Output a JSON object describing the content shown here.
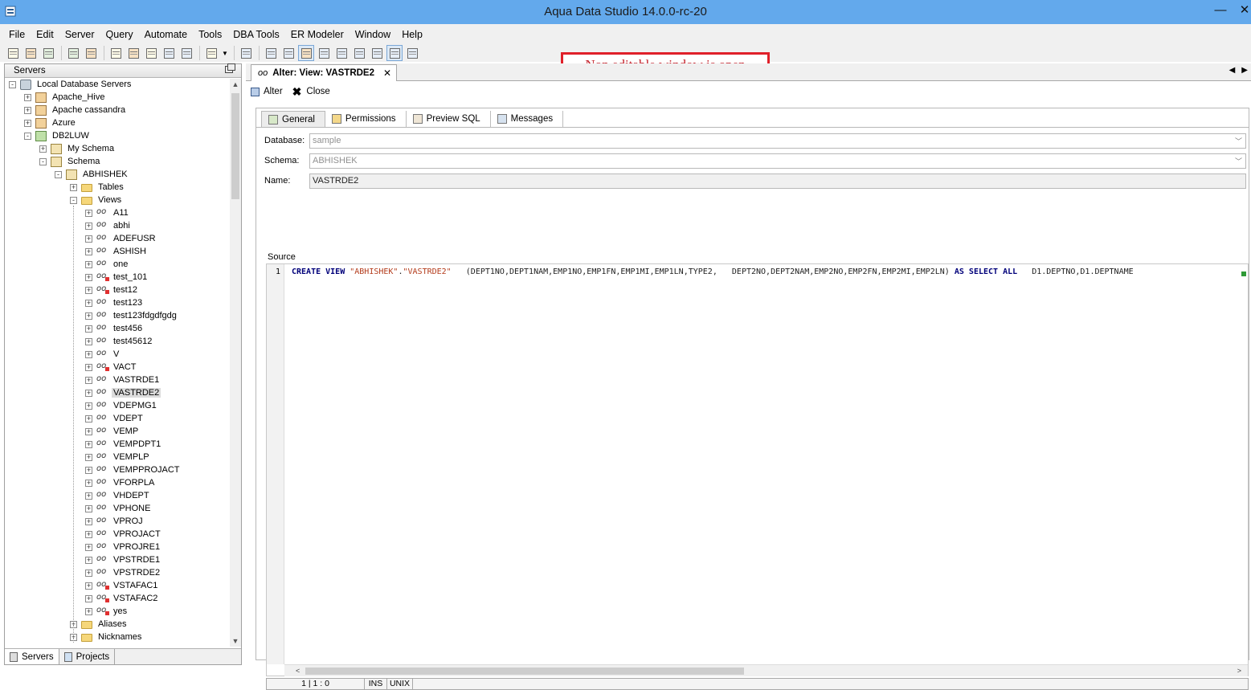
{
  "window": {
    "title": "Aqua Data Studio 14.0.0-rc-20",
    "min_glyph": "—",
    "close_glyph": "✕"
  },
  "menu": [
    "File",
    "Edit",
    "Server",
    "Query",
    "Automate",
    "Tools",
    "DBA Tools",
    "ER Modeler",
    "Window",
    "Help"
  ],
  "annotation": "Non editable window is open",
  "left_panel": {
    "title": "Servers",
    "tree": [
      {
        "label": "Local Database Servers",
        "depth": 0,
        "expander": "-",
        "icon": "srv"
      },
      {
        "label": "Apache_Hive",
        "depth": 1,
        "expander": "+",
        "icon": "db"
      },
      {
        "label": "Apache cassandra",
        "depth": 1,
        "expander": "+",
        "icon": "db"
      },
      {
        "label": "Azure",
        "depth": 1,
        "expander": "+",
        "icon": "db"
      },
      {
        "label": "DB2LUW",
        "depth": 1,
        "expander": "-",
        "icon": "dbg"
      },
      {
        "label": "My Schema",
        "depth": 2,
        "expander": "+",
        "icon": "sch"
      },
      {
        "label": "Schema",
        "depth": 2,
        "expander": "-",
        "icon": "sch"
      },
      {
        "label": "ABHISHEK",
        "depth": 3,
        "expander": "-",
        "icon": "sch"
      },
      {
        "label": "Tables",
        "depth": 4,
        "expander": "+",
        "icon": "folder"
      },
      {
        "label": "Views",
        "depth": 4,
        "expander": "-",
        "icon": "folder"
      },
      {
        "label": "A11",
        "depth": 5,
        "expander": "+",
        "icon": "view"
      },
      {
        "label": "abhi",
        "depth": 5,
        "expander": "+",
        "icon": "view"
      },
      {
        "label": "ADEFUSR",
        "depth": 5,
        "expander": "+",
        "icon": "view"
      },
      {
        "label": "ASHISH",
        "depth": 5,
        "expander": "+",
        "icon": "view"
      },
      {
        "label": "one",
        "depth": 5,
        "expander": "+",
        "icon": "view"
      },
      {
        "label": "test_101",
        "depth": 5,
        "expander": "+",
        "icon": "view-bad"
      },
      {
        "label": "test12",
        "depth": 5,
        "expander": "+",
        "icon": "view-bad"
      },
      {
        "label": "test123",
        "depth": 5,
        "expander": "+",
        "icon": "view"
      },
      {
        "label": "test123fdgdfgdg",
        "depth": 5,
        "expander": "+",
        "icon": "view"
      },
      {
        "label": "test456",
        "depth": 5,
        "expander": "+",
        "icon": "view"
      },
      {
        "label": "test45612",
        "depth": 5,
        "expander": "+",
        "icon": "view"
      },
      {
        "label": "V",
        "depth": 5,
        "expander": "+",
        "icon": "view"
      },
      {
        "label": "VACT",
        "depth": 5,
        "expander": "+",
        "icon": "view-bad"
      },
      {
        "label": "VASTRDE1",
        "depth": 5,
        "expander": "+",
        "icon": "view"
      },
      {
        "label": "VASTRDE2",
        "depth": 5,
        "expander": "+",
        "icon": "view",
        "selected": true
      },
      {
        "label": "VDEPMG1",
        "depth": 5,
        "expander": "+",
        "icon": "view"
      },
      {
        "label": "VDEPT",
        "depth": 5,
        "expander": "+",
        "icon": "view"
      },
      {
        "label": "VEMP",
        "depth": 5,
        "expander": "+",
        "icon": "view"
      },
      {
        "label": "VEMPDPT1",
        "depth": 5,
        "expander": "+",
        "icon": "view"
      },
      {
        "label": "VEMPLP",
        "depth": 5,
        "expander": "+",
        "icon": "view"
      },
      {
        "label": "VEMPPROJACT",
        "depth": 5,
        "expander": "+",
        "icon": "view"
      },
      {
        "label": "VFORPLA",
        "depth": 5,
        "expander": "+",
        "icon": "view"
      },
      {
        "label": "VHDEPT",
        "depth": 5,
        "expander": "+",
        "icon": "view"
      },
      {
        "label": "VPHONE",
        "depth": 5,
        "expander": "+",
        "icon": "view"
      },
      {
        "label": "VPROJ",
        "depth": 5,
        "expander": "+",
        "icon": "view"
      },
      {
        "label": "VPROJACT",
        "depth": 5,
        "expander": "+",
        "icon": "view"
      },
      {
        "label": "VPROJRE1",
        "depth": 5,
        "expander": "+",
        "icon": "view"
      },
      {
        "label": "VPSTRDE1",
        "depth": 5,
        "expander": "+",
        "icon": "view"
      },
      {
        "label": "VPSTRDE2",
        "depth": 5,
        "expander": "+",
        "icon": "view"
      },
      {
        "label": "VSTAFAC1",
        "depth": 5,
        "expander": "+",
        "icon": "view-bad"
      },
      {
        "label": "VSTAFAC2",
        "depth": 5,
        "expander": "+",
        "icon": "view-bad"
      },
      {
        "label": "yes",
        "depth": 5,
        "expander": "+",
        "icon": "view-bad"
      },
      {
        "label": "Aliases",
        "depth": 4,
        "expander": "+",
        "icon": "folder"
      },
      {
        "label": "Nicknames",
        "depth": 4,
        "expander": "+",
        "icon": "folder"
      }
    ],
    "bottom_tabs": [
      "Servers",
      "Projects"
    ]
  },
  "editor": {
    "tab_title": "Alter: View: VASTRDE2",
    "actions": {
      "alter": "Alter",
      "close": "Close"
    },
    "tabs": [
      "General",
      "Permissions",
      "Preview SQL",
      "Messages"
    ],
    "fields": {
      "database": {
        "label": "Database:",
        "value": "sample"
      },
      "schema": {
        "label": "Schema:",
        "value": "ABHISHEK"
      },
      "name": {
        "label": "Name:",
        "value": "VASTRDE2"
      }
    },
    "source_label": "Source",
    "line_number": "1",
    "code": [
      {
        "t": "CREATE VIEW ",
        "c": "kw"
      },
      {
        "t": "\"ABHISHEK\"",
        "c": "str"
      },
      {
        "t": ".",
        "c": "plain"
      },
      {
        "t": "\"VASTRDE2\"",
        "c": "str"
      },
      {
        "t": "   (DEPT1NO,DEPT1NAM,EMP1NO,EMP1FN,EMP1MI,EMP1LN,TYPE2,   DEPT2NO,DEPT2NAM,EMP2NO,EMP2FN,EMP2MI,EMP2LN) ",
        "c": "plain"
      },
      {
        "t": "AS SELECT ALL",
        "c": "kw"
      },
      {
        "t": "   D1.DEPTNO,D1.DEPTNAME",
        "c": "plain"
      }
    ],
    "status": {
      "position": "1 | 1 : 0",
      "mode": "INS",
      "eol": "UNIX"
    }
  }
}
